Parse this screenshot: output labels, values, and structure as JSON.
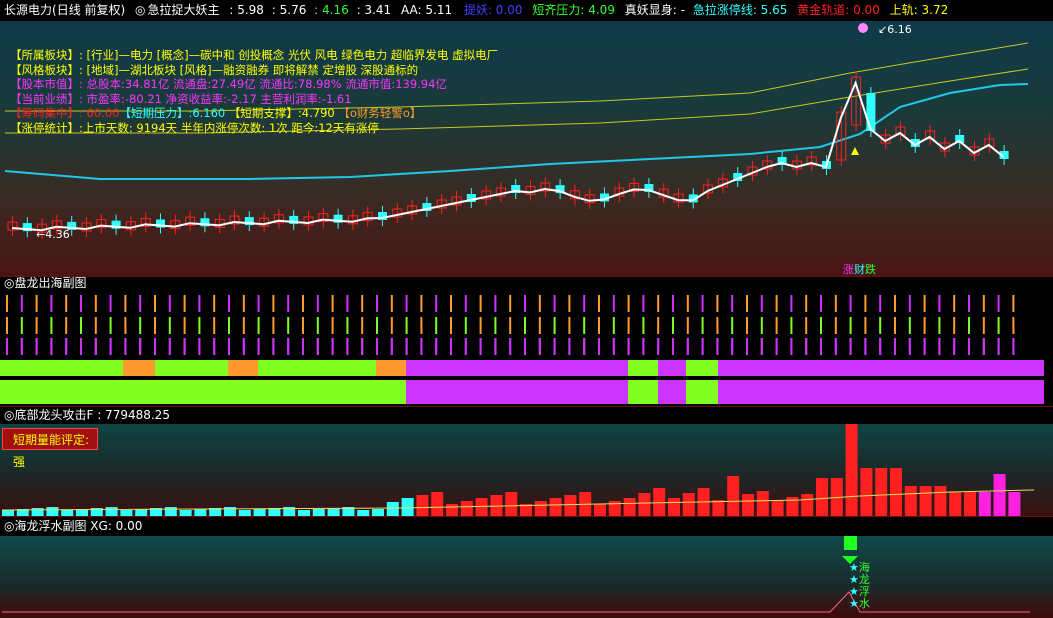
{
  "header": {
    "stock_name": "长源电力",
    "period": "(日线 前复权)",
    "indicator": "急拉捉大妖主",
    "v1": ": 5.98",
    "v2": ": 5.76",
    "v3": ": 4.16",
    "v4": ": 3.41",
    "aa": "AA: 5.11",
    "tiyao_label": "提妖",
    "tiyao_val": ": 0.00",
    "short_label": "短齐压力",
    "short_val": ": 4.09",
    "zhenyao": "真妖显身: -",
    "jila_label": "急拉涨停线",
    "jila_val": ": 5.65",
    "huangjin_label": "黄金轨道",
    "huangjin_val": ": 0.00",
    "shanggui_label": "上轨",
    "shanggui_val": ": 3.72"
  },
  "info": {
    "row1_label": "【所属板块】:",
    "row1_text": "[行业]—电力 [概念]—碳中和 创投概念 光伏 风电 绿色电力 超临界发电 虚拟电厂",
    "row2_label": "【风格板块】:",
    "row2_text": "[地域]—湖北板块 [风格]—融资融券 即将解禁 定增股 深股通标的",
    "row3_label": "【股本市值】:",
    "row3_text": "总股本:34.81亿 流通盘:27.49亿 流通比:78.98% 流通市值:139.94亿",
    "row4_label": "【当前业绩】:",
    "row4_text": "市盈率:-80.21 净资收益率:-2.17 主营利润率:-1.61",
    "row5_label": "【筹码集中】",
    "row5_a": ": 60.00",
    "row5_b": "【短期压力】",
    "row5_b_val": ":6.160",
    "row5_c": "【短期支撑】",
    "row5_c_val": ":4.790",
    "row5_d": "【o财务轻警o】",
    "row6_label": "【涨停统计】:",
    "row6_text": "上市天数: 9194天 半年内涨停次数: 1次   距今:12天有涨停"
  },
  "price_labels": {
    "high": "6.16",
    "low": "4.36",
    "zhang": "涨",
    "cai": "财",
    "die": "跌"
  },
  "panel2": {
    "title": "盘龙出海副图"
  },
  "panel3": {
    "title": "底部龙头攻击F : 779488.25",
    "chip_label": "短期量能评定:",
    "chip_value": "强"
  },
  "panel4": {
    "title": "海龙浮水副图 XG: 0.00",
    "marks": [
      "海",
      "龙",
      "浮",
      "水"
    ]
  },
  "colors": {
    "up": "#ff2020",
    "down": "#30ffff",
    "ma_cyan": "#20c8e8",
    "ma_yellow": "#c8c820",
    "green": "#80ff20",
    "orange": "#ff9a30",
    "magenta": "#cc33ff"
  }
}
